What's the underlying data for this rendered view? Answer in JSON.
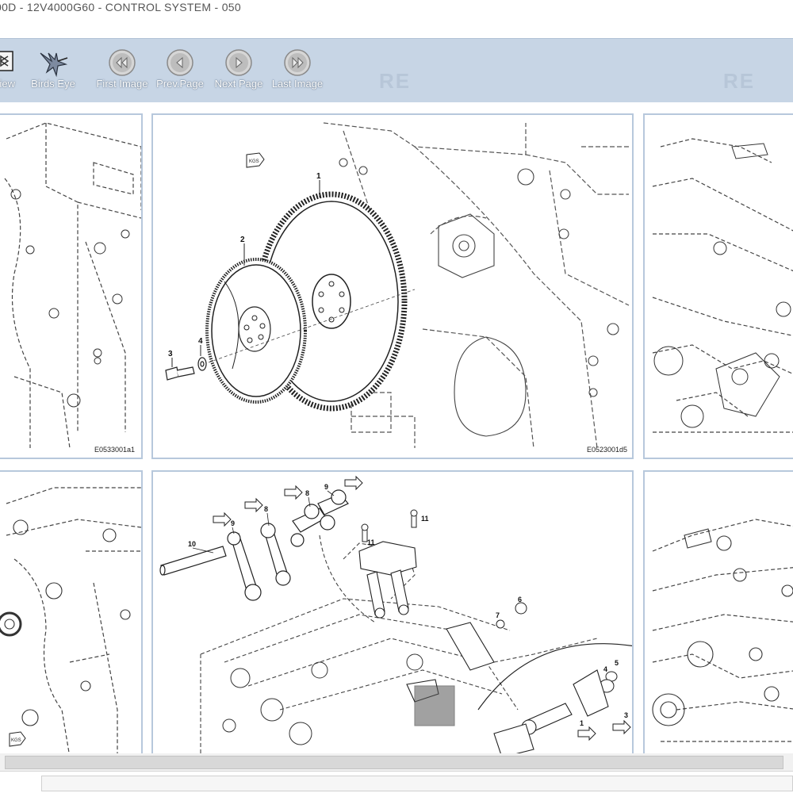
{
  "window": {
    "title": "00D - 12V4000G60 - CONTROL SYSTEM - 050"
  },
  "toolbar": {
    "buttons": [
      {
        "label": "View",
        "icon": "view-icon"
      },
      {
        "label": "Birds Eye",
        "icon": "hummingbird-icon"
      },
      {
        "label": "First Image",
        "icon": "double-left-arrow-icon"
      },
      {
        "label": "Prev.Page",
        "icon": "left-arrow-icon"
      },
      {
        "label": "Next Page",
        "icon": "right-arrow-icon"
      },
      {
        "label": "Last Image",
        "icon": "double-right-arrow-icon"
      }
    ],
    "watermark": "RE"
  },
  "panels": [
    {
      "code": "E0533001a1"
    },
    {
      "code": "E0523001d5",
      "callouts": [
        "1",
        "2",
        "3",
        "4"
      ],
      "tag": "KGS"
    },
    {
      "code": ""
    },
    {
      "code": "",
      "tag": "KGS"
    },
    {
      "code": "",
      "callouts": [
        "10",
        "9",
        "8",
        "8",
        "9",
        "11",
        "11",
        "6",
        "7",
        "4",
        "5",
        "1",
        "3"
      ]
    },
    {
      "code": ""
    }
  ],
  "colors": {
    "toolbar_bg": "#c7d5e5",
    "panel_border": "#b7c8dc",
    "button_face": "#d9d9d9"
  }
}
